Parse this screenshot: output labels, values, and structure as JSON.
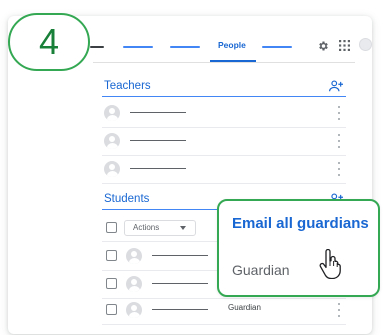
{
  "step": {
    "number": "4"
  },
  "nav": {
    "active_tab": "People"
  },
  "teachers": {
    "title": "Teachers",
    "rows": [
      {
        "line_width": 56
      },
      {
        "line_width": 56
      },
      {
        "line_width": 56
      }
    ]
  },
  "students": {
    "title": "Students",
    "actions_label": "Actions",
    "rows": [
      {
        "guardian": ""
      },
      {
        "guardian": ""
      },
      {
        "guardian": "Guardian"
      }
    ]
  },
  "guardian_menu": {
    "email_all": "Email all guardians",
    "guardian": "Guardian"
  },
  "colors": {
    "accent": "#1967d2",
    "highlight": "#34a853",
    "step_text": "#188038"
  },
  "icons": [
    "settings-gear-icon",
    "apps-grid-icon",
    "account-avatar-icon",
    "add-person-icon",
    "more-vert-icon",
    "hand-pointer-cursor-icon",
    "dropdown-caret-icon"
  ]
}
